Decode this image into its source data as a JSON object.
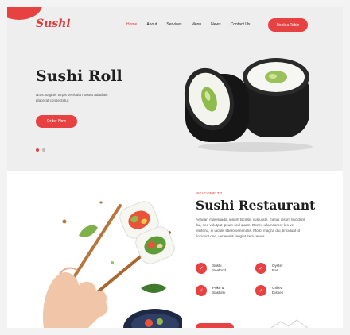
{
  "header": {
    "logo": "Sushi",
    "nav": [
      "Home",
      "About",
      "Services",
      "Menu",
      "News",
      "Contact Us"
    ],
    "active_nav": "Home",
    "cta": "Book a Table"
  },
  "hero": {
    "title": "Sushi Roll",
    "text": "Nunc sagittis turpis vehicula maseu adadiatir placerat consectetur.",
    "button": "Order Now",
    "slides": 2,
    "active_slide": 1
  },
  "about": {
    "eyebrow": "WELCOME TO",
    "title": "Sushi Restaurant",
    "text": "Aenean malesuada, ipsum facilisis vulputate, metus ipsum tincidunt dui, sed volutpat ipsum sed quam. Donec ullamcorper leo vel eleifend, in iaculis libero venenatis. Morbi magna dui, tincidunt id tincidunt nec, venenatis feugiat sem tenuis.",
    "features": [
      {
        "line1": "Sushi",
        "line2": "Seafood"
      },
      {
        "line1": "Oyster",
        "line2": "Bar"
      },
      {
        "line1": "Poke &",
        "line2": "Sashimi"
      },
      {
        "line1": "Grilled",
        "line2": "Dishes"
      }
    ]
  },
  "colors": {
    "accent": "#e84141",
    "hero_bg": "#eeeeee",
    "text_dark": "#1f1f1f"
  }
}
